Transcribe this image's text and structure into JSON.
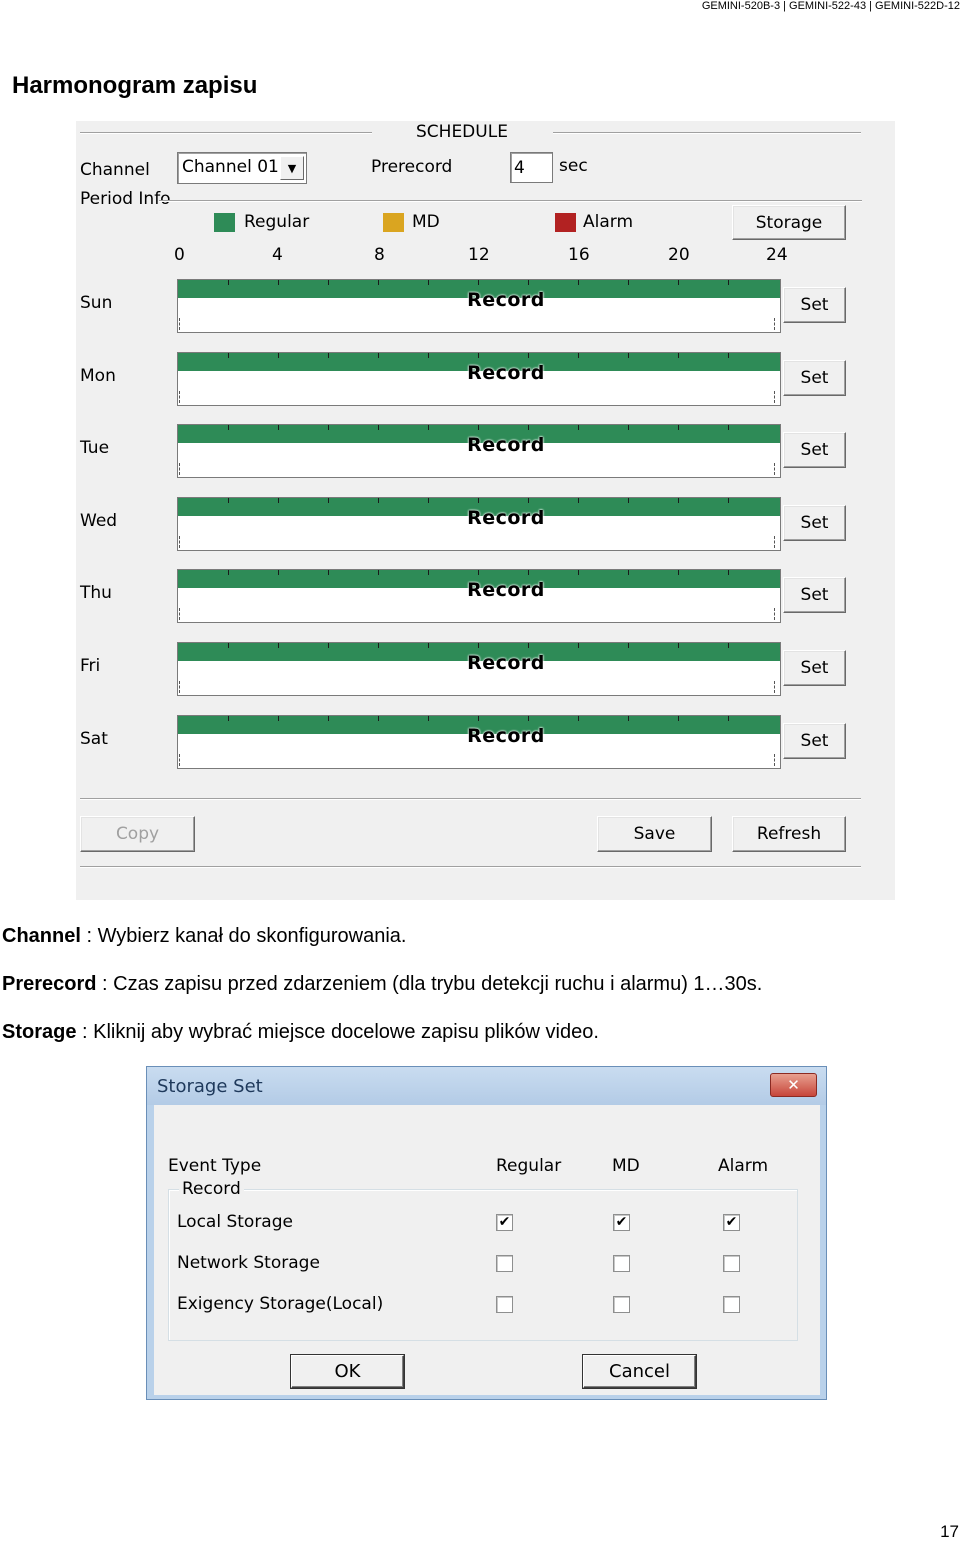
{
  "header": {
    "models": "GEMINI-520B-3 | GEMINI-522-43 | GEMINI-522D-12"
  },
  "page_title": "Harmonogram zapisu",
  "schedule": {
    "title": "SCHEDULE",
    "channel_label": "Channel",
    "channel_value": "Channel 01",
    "prerecord_label": "Prerecord",
    "prerecord_value": "4",
    "prerecord_unit": "sec",
    "period_info_label": "Period Info",
    "legend": [
      {
        "label": "Regular",
        "color": "#2e8b57"
      },
      {
        "label": "MD",
        "color": "#daa520"
      },
      {
        "label": "Alarm",
        "color": "#b22222"
      }
    ],
    "storage_button": "Storage",
    "hours": [
      "0",
      "4",
      "8",
      "12",
      "16",
      "20",
      "24"
    ],
    "days": [
      {
        "label": "Sun",
        "record": "Record",
        "set": "Set"
      },
      {
        "label": "Mon",
        "record": "Record",
        "set": "Set"
      },
      {
        "label": "Tue",
        "record": "Record",
        "set": "Set"
      },
      {
        "label": "Wed",
        "record": "Record",
        "set": "Set"
      },
      {
        "label": "Thu",
        "record": "Record",
        "set": "Set"
      },
      {
        "label": "Fri",
        "record": "Record",
        "set": "Set"
      },
      {
        "label": "Sat",
        "record": "Record",
        "set": "Set"
      }
    ],
    "copy_button": "Copy",
    "save_button": "Save",
    "refresh_button": "Refresh"
  },
  "descriptions": [
    {
      "term": "Channel",
      "text": " : Wybierz kanał do skonfigurowania."
    },
    {
      "term": "Prerecord",
      "text": " : Czas zapisu przed zdarzeniem (dla trybu detekcji ruchu i alarmu) 1…30s."
    },
    {
      "term": "Storage",
      "text": " : Kliknij aby wybrać miejsce docelowe zapisu plików video."
    }
  ],
  "storage_dialog": {
    "title": "Storage Set",
    "event_type_label": "Event Type",
    "columns": [
      "Regular",
      "MD",
      "Alarm"
    ],
    "group_label": "Record",
    "rows": [
      {
        "label": "Local Storage",
        "checked": [
          true,
          true,
          true
        ]
      },
      {
        "label": "Network Storage",
        "checked": [
          false,
          false,
          false
        ]
      },
      {
        "label": "Exigency Storage(Local)",
        "checked": [
          false,
          false,
          false
        ]
      }
    ],
    "ok_button": "OK",
    "cancel_button": "Cancel"
  },
  "page_number": "17"
}
